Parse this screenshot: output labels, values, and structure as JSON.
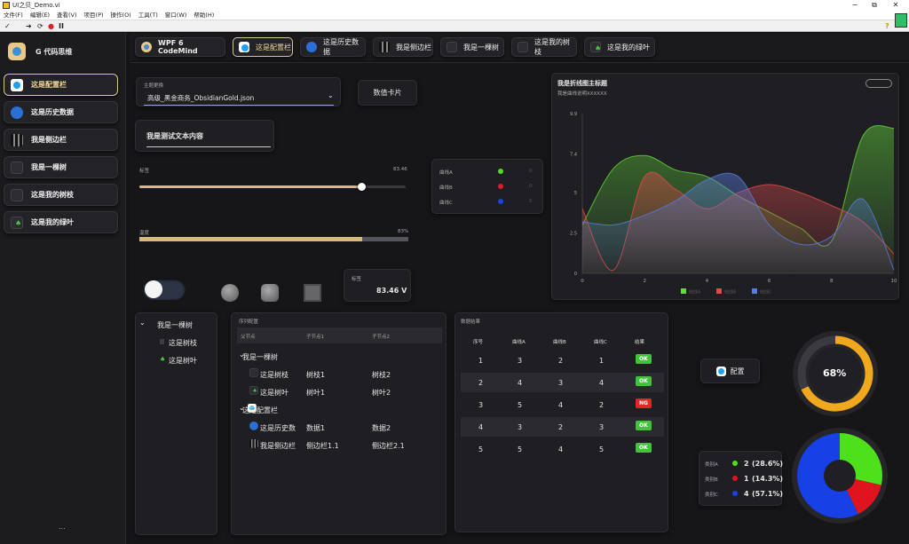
{
  "window": {
    "title": "UI之贝_Demo.vi",
    "minimize": "−",
    "restore": "⧉",
    "close": "✕"
  },
  "menu": [
    "文件(F)",
    "编辑(E)",
    "查看(V)",
    "项目(P)",
    "操作(O)",
    "工具(T)",
    "窗口(W)",
    "帮助(H)"
  ],
  "toolbar": {
    "check": "✓",
    "run": "➜",
    "run_cont": "⟳",
    "abort": "●",
    "pause": "II",
    "help": "?"
  },
  "sidebar": {
    "brand": "G 代码思维",
    "items": [
      {
        "label": "这是配置栏",
        "icon": "gear-icon",
        "active": true
      },
      {
        "label": "这是历史数据",
        "icon": "pie-icon",
        "active": false
      },
      {
        "label": "我是侧边栏",
        "icon": "grid-icon",
        "active": false
      },
      {
        "label": "我是一棵树",
        "icon": "tree-icon",
        "active": false
      },
      {
        "label": "这是我的树枝",
        "icon": "branch-icon",
        "active": false
      },
      {
        "label": "这是我的绿叶",
        "icon": "leaf-icon",
        "active": false
      }
    ],
    "footer": "..."
  },
  "topnav": {
    "brand": "WPF 6 CodeMind",
    "tabs": [
      {
        "label": "这是配置栏",
        "icon": "gear-icon",
        "active": true
      },
      {
        "label": "这是历史数据",
        "icon": "pie-icon",
        "active": false
      },
      {
        "label": "我是侧边栏",
        "icon": "grid-icon",
        "active": false
      },
      {
        "label": "我是一棵树",
        "icon": "tree-icon",
        "active": false
      },
      {
        "label": "这是我的树枝",
        "icon": "branch-icon",
        "active": false
      },
      {
        "label": "这是我的绿叶",
        "icon": "leaf-icon",
        "active": false
      }
    ]
  },
  "theme": {
    "label": "主题更换",
    "value": "高级_黑金商务_ObsidianGold.json"
  },
  "value_card": "数值卡片",
  "test_text": "我是测试文本内容",
  "slider": {
    "label": "标签",
    "value": "83.46",
    "fraction": 0.8346
  },
  "progress": {
    "label": "温度",
    "value": "83%",
    "fraction": 0.83
  },
  "numeric": {
    "label": "标签",
    "value": "83.46 V"
  },
  "toggle": {
    "on": false
  },
  "curve_legend": [
    {
      "name": "曲线A",
      "color": "#4cdc1e",
      "value": "0"
    },
    {
      "name": "曲线B",
      "color": "#e0182a",
      "value": "0"
    },
    {
      "name": "曲线C",
      "color": "#1842e0",
      "value": "0"
    }
  ],
  "chart_data": {
    "type": "area",
    "title": "我是折线图主标题",
    "subtitle": "我是曲线说明XXXXXX",
    "x": [
      0,
      1,
      2,
      3,
      4,
      5,
      6,
      7,
      8,
      9,
      10
    ],
    "xticks": [
      "0",
      "2",
      "4",
      "6",
      "8",
      "10"
    ],
    "yticks": [
      "0",
      "2.5",
      "5",
      "7.4",
      "9.9"
    ],
    "ylim": [
      0,
      9.9
    ],
    "xlim": [
      0,
      10
    ],
    "series": [
      {
        "name": "曲线A",
        "color": "#63d93a",
        "values": [
          3,
          6.5,
          7.3,
          6.4,
          6.0,
          4.8,
          3.8,
          2.8,
          2.0,
          8.5,
          9.0
        ]
      },
      {
        "name": "曲线B",
        "color": "#e04a4a",
        "values": [
          4.0,
          0.2,
          6.0,
          5.2,
          4.0,
          5.0,
          5.5,
          5.0,
          4.2,
          3.2,
          1.2
        ]
      },
      {
        "name": "曲线C",
        "color": "#5a7ce0",
        "values": [
          3.2,
          3.0,
          3.6,
          4.5,
          5.8,
          6.0,
          3.0,
          1.8,
          2.3,
          4.6,
          0.2
        ]
      }
    ],
    "legend": [
      "曲线A",
      "曲线B",
      "曲线C"
    ],
    "legend_position": "bottom",
    "grid": false
  },
  "tree": {
    "root": "我是一棵树",
    "children": [
      "这是树枝",
      "这是树叶"
    ]
  },
  "sequence": {
    "title": "序列配置",
    "columns": [
      "父节点",
      "子节点1",
      "子节点2"
    ],
    "rows": [
      {
        "indent": 0,
        "expand": "⌄",
        "icon": "",
        "label": "我是一棵树",
        "c1": "",
        "c2": ""
      },
      {
        "indent": 1,
        "expand": "",
        "icon": "branch-icon",
        "label": "这是树枝",
        "c1": "树枝1",
        "c2": "树枝2"
      },
      {
        "indent": 1,
        "expand": "",
        "icon": "leaf-icon",
        "label": "这是树叶",
        "c1": "树叶1",
        "c2": "树叶2"
      },
      {
        "indent": 0,
        "expand": "⌄",
        "icon": "gear-icon",
        "label": "这是配置栏",
        "c1": "",
        "c2": ""
      },
      {
        "indent": 1,
        "expand": "",
        "icon": "pie-icon",
        "label": "这是历史数",
        "c1": "数据1",
        "c2": "数据2"
      },
      {
        "indent": 1,
        "expand": "",
        "icon": "grid-icon",
        "label": "我是侧边栏",
        "c1": "侧边栏1.1",
        "c2": "侧边栏2.1"
      }
    ]
  },
  "results": {
    "title": "数据结果",
    "columns": [
      "序号",
      "曲线A",
      "曲线B",
      "曲线C",
      "结果"
    ],
    "rows": [
      [
        "1",
        "3",
        "2",
        "1",
        "OK"
      ],
      [
        "2",
        "4",
        "3",
        "4",
        "OK"
      ],
      [
        "3",
        "5",
        "4",
        "2",
        "NG"
      ],
      [
        "4",
        "3",
        "2",
        "3",
        "OK"
      ],
      [
        "5",
        "5",
        "4",
        "5",
        "OK"
      ]
    ]
  },
  "config_button": "配置",
  "gauge": {
    "value": "68%",
    "fraction": 0.68,
    "color": "#f0a91c"
  },
  "pie": {
    "items": [
      {
        "name": "类别A",
        "color": "#4ee01a",
        "count": "2",
        "pct": "(28.6%)",
        "value": 2
      },
      {
        "name": "类别B",
        "color": "#e0141e",
        "count": "1",
        "pct": "(14.3%)",
        "value": 1
      },
      {
        "name": "类别C",
        "color": "#1740e6",
        "count": "4",
        "pct": "(57.1%)",
        "value": 4
      }
    ]
  }
}
